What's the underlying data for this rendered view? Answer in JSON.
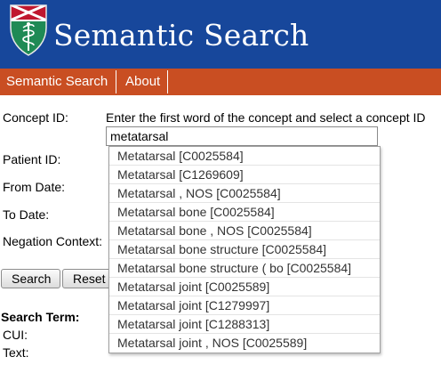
{
  "header": {
    "title": "Semantic Search",
    "logo_icon": "caduceus-shield-icon",
    "colors": {
      "background": "#17479b",
      "text": "#ffffff"
    }
  },
  "nav": {
    "items": [
      {
        "label": "Semantic Search"
      },
      {
        "label": "About"
      }
    ],
    "colors": {
      "background": "#c94e22",
      "text": "#ffffff"
    }
  },
  "form": {
    "concept_label": "Concept ID:",
    "concept_instruction": "Enter the first word of the concept and select a concept ID",
    "concept_value": "metatarsal",
    "patient_label": "Patient ID:",
    "from_date_label": "From Date:",
    "to_date_label": "To Date:",
    "negation_label": "Negation Context:",
    "search_button": "Search",
    "reset_button": "Reset"
  },
  "results": {
    "title": "Search Term:",
    "cui_label": "CUI:",
    "text_label": "Text:"
  },
  "autocomplete": {
    "items": [
      {
        "label": "Metatarsal [C0025584]"
      },
      {
        "label": "Metatarsal [C1269609]"
      },
      {
        "label": "Metatarsal , NOS [C0025584]"
      },
      {
        "label": "Metatarsal bone [C0025584]"
      },
      {
        "label": "Metatarsal bone , NOS [C0025584]"
      },
      {
        "label": "Metatarsal bone structure [C0025584]"
      },
      {
        "label": "Metatarsal bone structure ( bo [C0025584]"
      },
      {
        "label": "Metatarsal joint [C0025589]"
      },
      {
        "label": "Metatarsal joint [C1279997]"
      },
      {
        "label": "Metatarsal joint [C1288313]"
      },
      {
        "label": "Metatarsal joint , NOS [C0025589]"
      }
    ]
  }
}
